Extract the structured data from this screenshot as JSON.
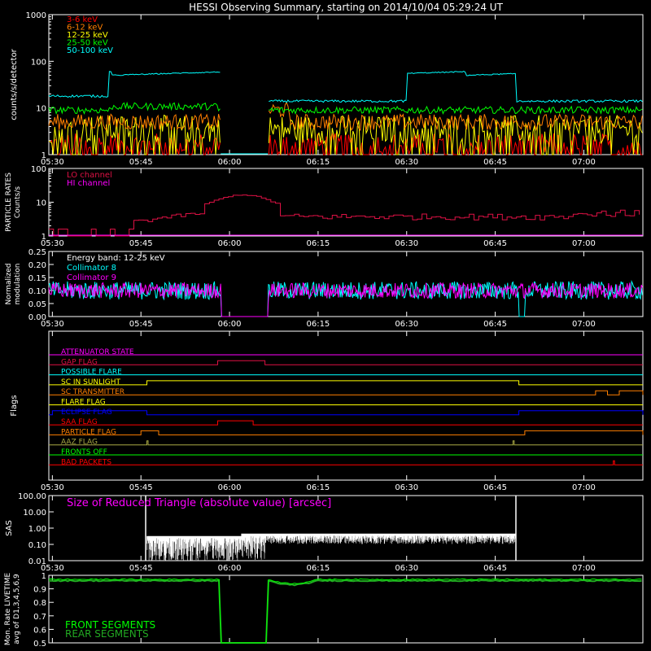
{
  "title": "HESSI Observing Summary, starting on 2014/10/04 05:29:24 UT",
  "time_ticks": [
    "05:30",
    "05:45",
    "06:00",
    "06:15",
    "06:30",
    "06:45",
    "07:00"
  ],
  "colors": {
    "red": "#ff0000",
    "orange": "#ff7f00",
    "yellow": "#ffff00",
    "green": "#00ff00",
    "cyan": "#00ffff",
    "magenta": "#ff00ff",
    "crimson": "#dd1144",
    "white": "#ffffff",
    "blue": "#0000ff",
    "olive": "#aaaa44",
    "darkgreen": "#22aa22"
  },
  "chart_data": [
    {
      "type": "line",
      "ylabel": "counts/s/detector",
      "yscale": "log",
      "ylim": [
        1,
        1000
      ],
      "ytick_labels": [
        "1",
        "10",
        "100",
        "1000"
      ],
      "series": [
        {
          "name": "3-6 keV",
          "color": "red",
          "approx_level": 1.6
        },
        {
          "name": "6-12 keV",
          "color": "orange",
          "approx_level": 5
        },
        {
          "name": "12-25 keV",
          "color": "yellow",
          "approx_level": 3.5
        },
        {
          "name": "25-50 keV",
          "color": "green",
          "approx_level": 9
        },
        {
          "name": "50-100 keV",
          "color": "cyan",
          "approx_level": 20,
          "saa_level": 50
        }
      ]
    },
    {
      "type": "line",
      "ylabel": "PARTICLE RATES Counts/s",
      "yscale": "log",
      "ylim": [
        1,
        100
      ],
      "ytick_labels": [
        "1",
        "10",
        "100"
      ],
      "series": [
        {
          "name": "LO channel",
          "color": "crimson",
          "approx_level": 3,
          "peak": 12
        },
        {
          "name": "HI channel",
          "color": "magenta",
          "approx_level": 1
        }
      ]
    },
    {
      "type": "line",
      "ylabel": "Normalized modulation",
      "ylim": [
        0,
        0.25
      ],
      "ytick_labels": [
        "0.00",
        "0.05",
        "0.10",
        "0.15",
        "0.20",
        "0.25"
      ],
      "annotation": "Energy band: 12-25 keV",
      "series": [
        {
          "name": "Collimator 8",
          "color": "cyan",
          "approx_level": 0.1
        },
        {
          "name": "Collimator 9",
          "color": "magenta",
          "approx_level": 0.1
        }
      ]
    },
    {
      "type": "line",
      "ylabel": "Flags",
      "flags": [
        {
          "name": "ATTENUATOR STATE",
          "color": "magenta",
          "on": []
        },
        {
          "name": "GAP FLAG",
          "color": "crimson",
          "on": [
            [
              "05:58",
              "06:06"
            ]
          ]
        },
        {
          "name": "POSSIBLE FLARE",
          "color": "cyan",
          "on": []
        },
        {
          "name": "SC IN SUNLIGHT",
          "color": "yellow",
          "on": [
            [
              "05:46",
              "06:49"
            ]
          ]
        },
        {
          "name": "SC TRANSMITTER",
          "color": "orange",
          "on": [
            [
              "07:02",
              "07:04"
            ],
            [
              "07:06",
              "07:10"
            ]
          ]
        },
        {
          "name": "FLARE FLAG",
          "color": "yellow",
          "on": []
        },
        {
          "name": "ECLIPSE FLAG",
          "color": "blue",
          "on": [
            [
              "05:30",
              "05:46"
            ],
            [
              "06:49",
              "07:10"
            ]
          ]
        },
        {
          "name": "SAA FLAG",
          "color": "red",
          "on": [
            [
              "05:58",
              "06:04"
            ]
          ]
        },
        {
          "name": "PARTICLE FLAG",
          "color": "orange",
          "on": [
            [
              "05:45",
              "05:48"
            ],
            [
              "06:50",
              "07:10"
            ]
          ]
        },
        {
          "name": "AAZ FLAG",
          "color": "olive",
          "on": [
            [
              "05:46",
              "05:46"
            ],
            [
              "06:48",
              "06:48"
            ]
          ]
        },
        {
          "name": "FRONTS OFF",
          "color": "green",
          "on": []
        },
        {
          "name": "BAD PACKETS",
          "color": "red",
          "on": [
            [
              "07:05",
              "07:05"
            ]
          ]
        }
      ]
    },
    {
      "type": "line",
      "ylabel": "SAS",
      "yscale": "log",
      "ylim": [
        0.01,
        100
      ],
      "ytick_labels": [
        "0.01",
        "0.10",
        "1.00",
        "10.00",
        "100.00"
      ],
      "annotation": "Size of Reduced Triangle (absolute value) [arcsec]",
      "series": [
        {
          "name": "Size of Reduced Triangle",
          "color": "white",
          "approx_level": 0.3
        }
      ]
    },
    {
      "type": "line",
      "ylabel": "Mon. Rate LIVETIME avg of D1,3,4,5,6,9",
      "ylim": [
        0.5,
        1.0
      ],
      "ytick_labels": [
        "0.5",
        "0.6",
        "0.7",
        "0.8",
        "0.9",
        "1"
      ],
      "series": [
        {
          "name": "FRONT SEGMENTS",
          "color": "green",
          "approx_level": 0.97
        },
        {
          "name": "REAR SEGMENTS",
          "color": "darkgreen",
          "approx_level": 0.96
        }
      ]
    }
  ]
}
